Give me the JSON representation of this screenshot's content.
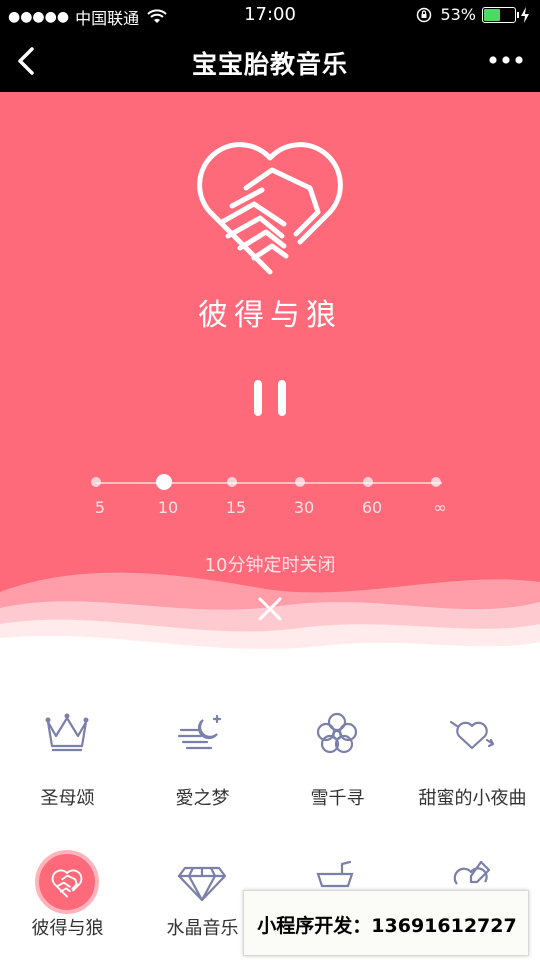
{
  "status_bar": {
    "signal": "●●●●●",
    "carrier": "中国联通",
    "time": "17:00",
    "battery_percent": "53%",
    "battery_level": 0.53
  },
  "nav": {
    "title": "宝宝胎教音乐"
  },
  "player": {
    "song_title": "彼得与狼",
    "timer_options": [
      "5",
      "10",
      "15",
      "30",
      "60",
      "∞"
    ],
    "selected_timer": "10",
    "timer_text": "10分钟定时关闭"
  },
  "songs": [
    {
      "label": "圣母颂",
      "icon": "crown-icon"
    },
    {
      "label": "愛之梦",
      "icon": "moon-stars-icon"
    },
    {
      "label": "雪千寻",
      "icon": "flower-icon"
    },
    {
      "label": "甜蜜的小夜曲",
      "icon": "heart-arrow-icon"
    },
    {
      "label": "彼得与狼",
      "icon": "heart-handshake-icon",
      "active": true
    },
    {
      "label": "水晶音乐",
      "icon": "diamond-icon"
    },
    {
      "label": "",
      "icon": "stroller-icon"
    },
    {
      "label": "",
      "icon": "heart-pencil-icon"
    }
  ],
  "ad": {
    "text": "小程序开发：13691612727"
  },
  "colors": {
    "accent": "#ff6a7a",
    "icon": "#7b80a8"
  }
}
